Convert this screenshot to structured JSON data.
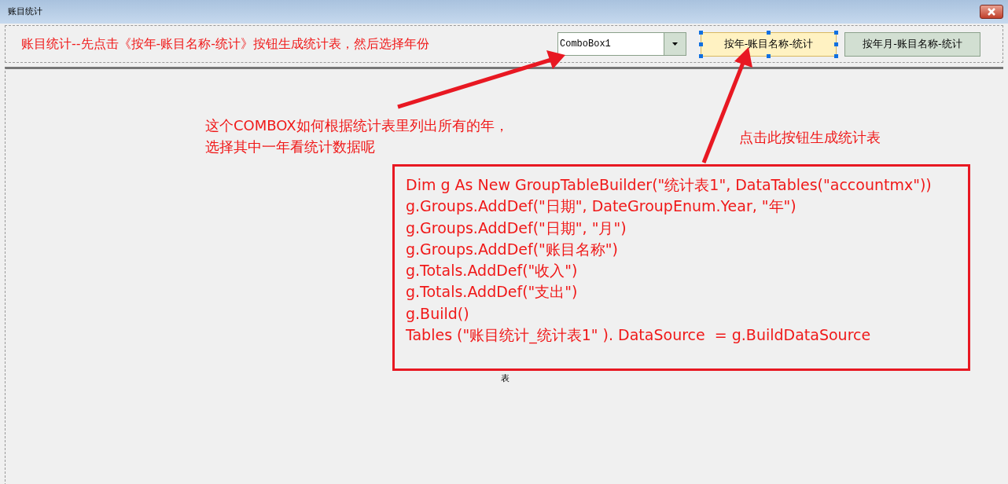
{
  "window": {
    "title": "账目统计"
  },
  "toolbar": {
    "instruction": "账目统计--先点击《按年-账目名称-统计》按钮生成统计表，然后选择年份",
    "combobox": {
      "value": "ComboBox1"
    },
    "buttons": [
      {
        "label": "按年-账目名称-统计",
        "selected": true
      },
      {
        "label": "按年月-账目名称-统计",
        "selected": false
      }
    ]
  },
  "annotations": [
    {
      "lines": [
        "这个COMBOX如何根据统计表里列出所有的年，",
        "选择其中一年看统计数据呢"
      ]
    },
    {
      "lines": [
        "点击此按钮生成统计表"
      ]
    }
  ],
  "code_lines": [
    "Dim g As New GroupTableBuilder(\"统计表1\", DataTables(\"accountmx\"))",
    "g.Groups.AddDef(\"日期\", DateGroupEnum.Year, \"年\")",
    "g.Groups.AddDef(\"日期\", \"月\")",
    "g.Groups.AddDef(\"账目名称\")",
    "g.Totals.AddDef(\"收入\")",
    "g.Totals.AddDef(\"支出\")",
    "g.Build()",
    "Tables (\"账目统计_统计表1\" ). DataSource  = g.BuildDataSource"
  ],
  "table_label": "表"
}
